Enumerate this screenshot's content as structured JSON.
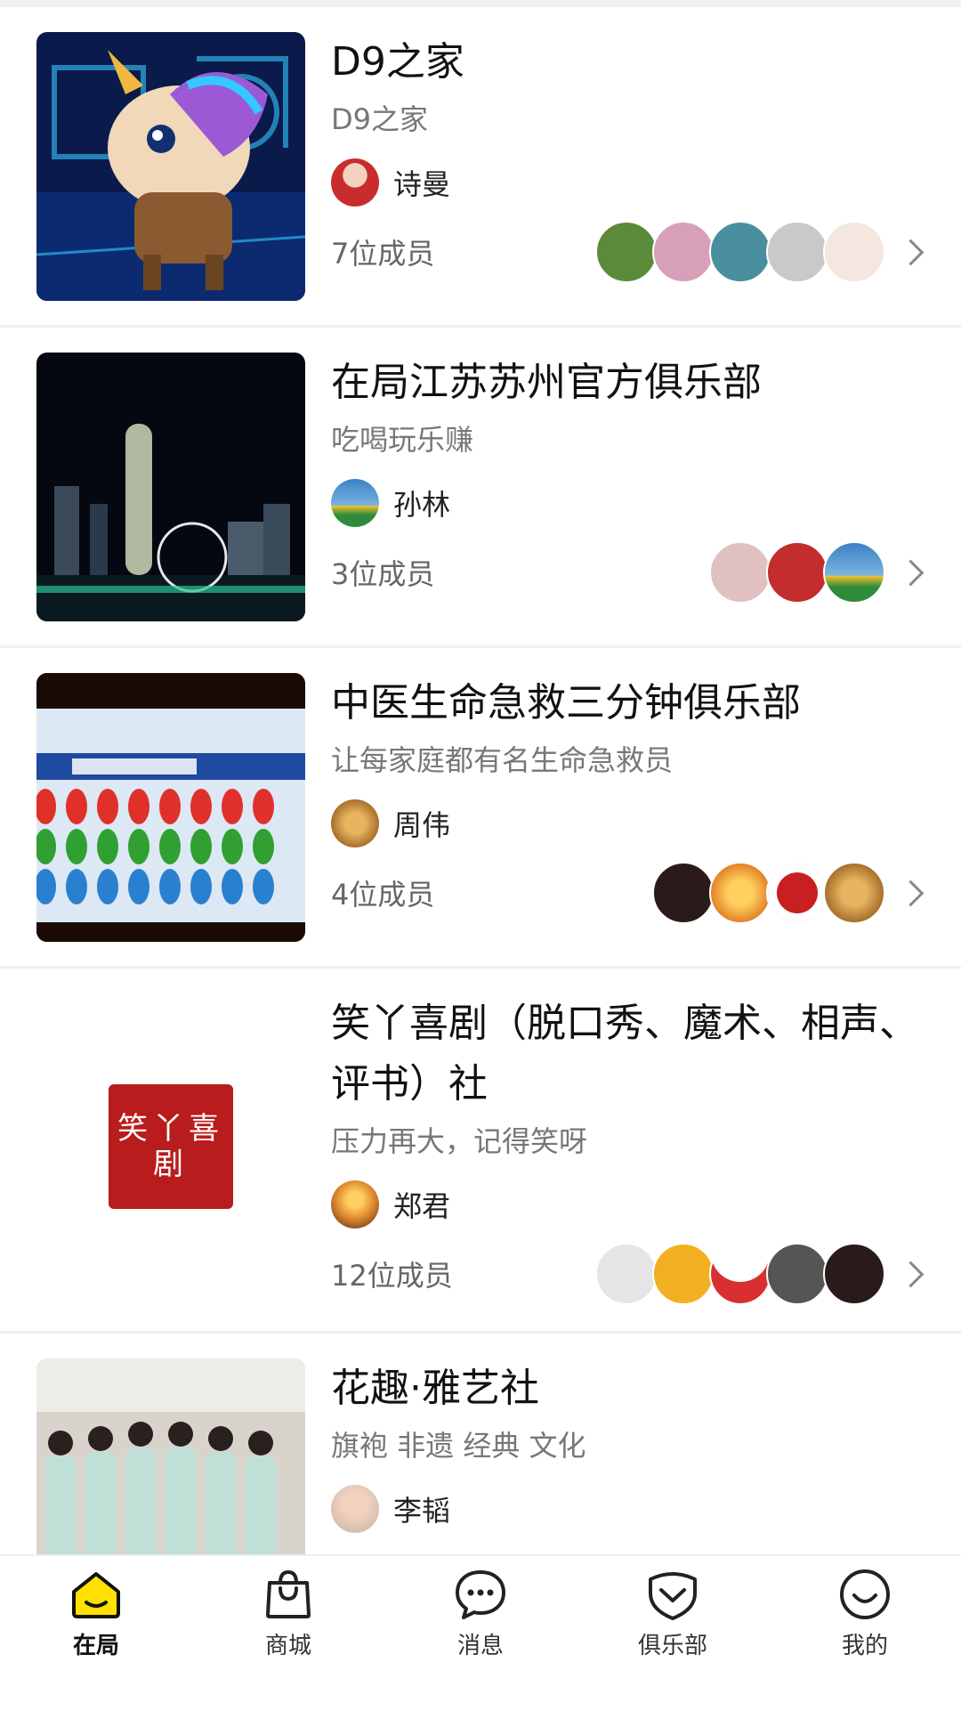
{
  "clubs": [
    {
      "title": "D9之家",
      "subtitle": "D9之家",
      "owner": "诗曼",
      "members": "7位成员",
      "avatar_colors": [
        "#5a8a3a",
        "#d7a0b8",
        "#4a8fa0",
        "#c9c9c9",
        "#f3e7e0"
      ],
      "owner_color": "#c82c2c"
    },
    {
      "title": "在局江苏苏州官方俱乐部",
      "subtitle": "吃喝玩乐赚",
      "owner": "孙林",
      "members": "3位成员",
      "avatar_colors": [
        "#e0c0c0",
        "#c42d2d",
        "#3b82c4"
      ],
      "owner_color": "#3b82c4"
    },
    {
      "title": "中医生命急救三分钟俱乐部",
      "subtitle": "让每家庭都有名生命急救员",
      "owner": "周伟",
      "members": "4位成员",
      "avatar_colors": [
        "#2a1a1a",
        "#f0a030",
        "#ffffff",
        "#c8902c"
      ],
      "owner_color": "#c8902c"
    },
    {
      "title": "笑丫喜剧（脱口秀、魔术、相声、评书）社",
      "subtitle": "压力再大，记得笑呀",
      "owner": "郑君",
      "members": "12位成员",
      "avatar_colors": [
        "#e5e5e5",
        "#f2b020",
        "#ffffff",
        "#555555",
        "#2a1a1a"
      ],
      "owner_color": "#e89030"
    },
    {
      "title": "花趣·雅艺社",
      "subtitle": "旗袍 非遗 经典 文化",
      "owner": "李韬",
      "members": "",
      "avatar_colors": [],
      "owner_color": "#d8c0b0"
    }
  ],
  "seal_text": "笑丫喜剧",
  "tabs": [
    {
      "label": "在局",
      "icon": "home-icon"
    },
    {
      "label": "商城",
      "icon": "bag-icon"
    },
    {
      "label": "消息",
      "icon": "message-icon"
    },
    {
      "label": "俱乐部",
      "icon": "club-icon"
    },
    {
      "label": "我的",
      "icon": "profile-icon"
    }
  ],
  "colors": {
    "accent": "#ffe000",
    "seal_red": "#b91c1c"
  }
}
